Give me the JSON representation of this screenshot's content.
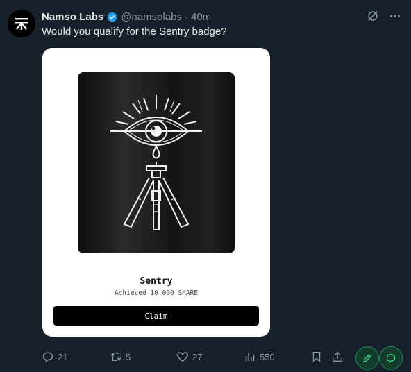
{
  "post": {
    "author_name": "Namso Labs",
    "handle": "@namsolabs",
    "separator": "·",
    "time": "40m",
    "text": "Would you qualify for the Sentry badge?"
  },
  "card": {
    "badge_title": "Sentry",
    "badge_subtitle": "Achieved 10,000 SHARE",
    "claim_label": "Claim"
  },
  "actions": {
    "replies": "21",
    "reposts": "5",
    "likes": "27",
    "views": "550"
  },
  "colors": {
    "background": "#15202b",
    "verified": "#1d9bf0",
    "muted": "#8b98a5",
    "green": "#1f8a55"
  }
}
